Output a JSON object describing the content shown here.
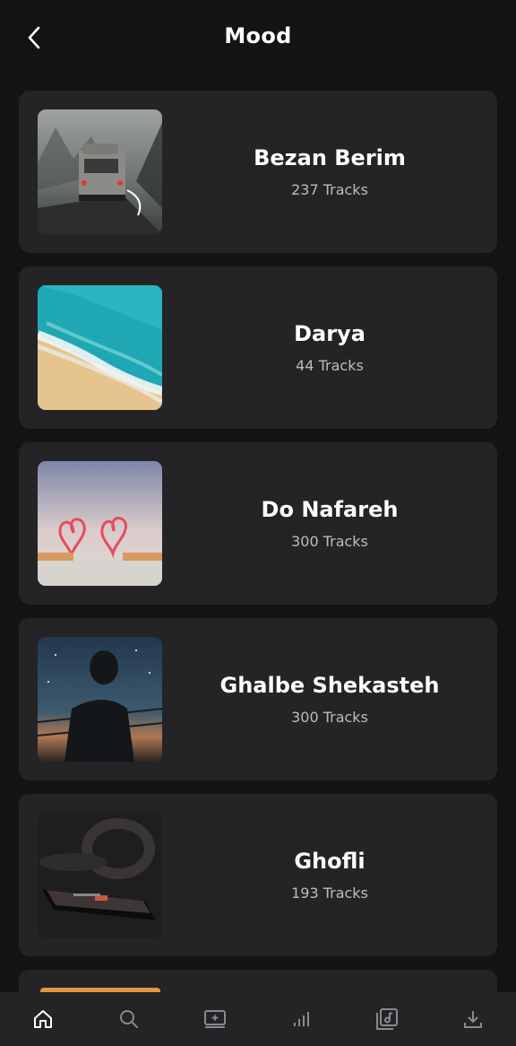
{
  "header": {
    "title": "Mood",
    "back_icon": "chevron-left-icon"
  },
  "moods": [
    {
      "title": "Bezan Berim",
      "count": "237 Tracks"
    },
    {
      "title": "Darya",
      "count": "44 Tracks"
    },
    {
      "title": "Do Nafareh",
      "count": "300 Tracks"
    },
    {
      "title": "Ghalbe Shekasteh",
      "count": "300 Tracks"
    },
    {
      "title": "Ghofli",
      "count": "193 Tracks"
    }
  ],
  "bottom_nav": {
    "items": [
      "home-icon",
      "search-icon",
      "browse-icon",
      "charts-icon",
      "library-icon",
      "download-icon"
    ],
    "active": "home-icon"
  },
  "colors": {
    "background": "#141316",
    "card": "#242326",
    "muted_text": "#bdbcc0",
    "active_icon": "#ffffff",
    "inactive_icon": "#8a898e"
  }
}
